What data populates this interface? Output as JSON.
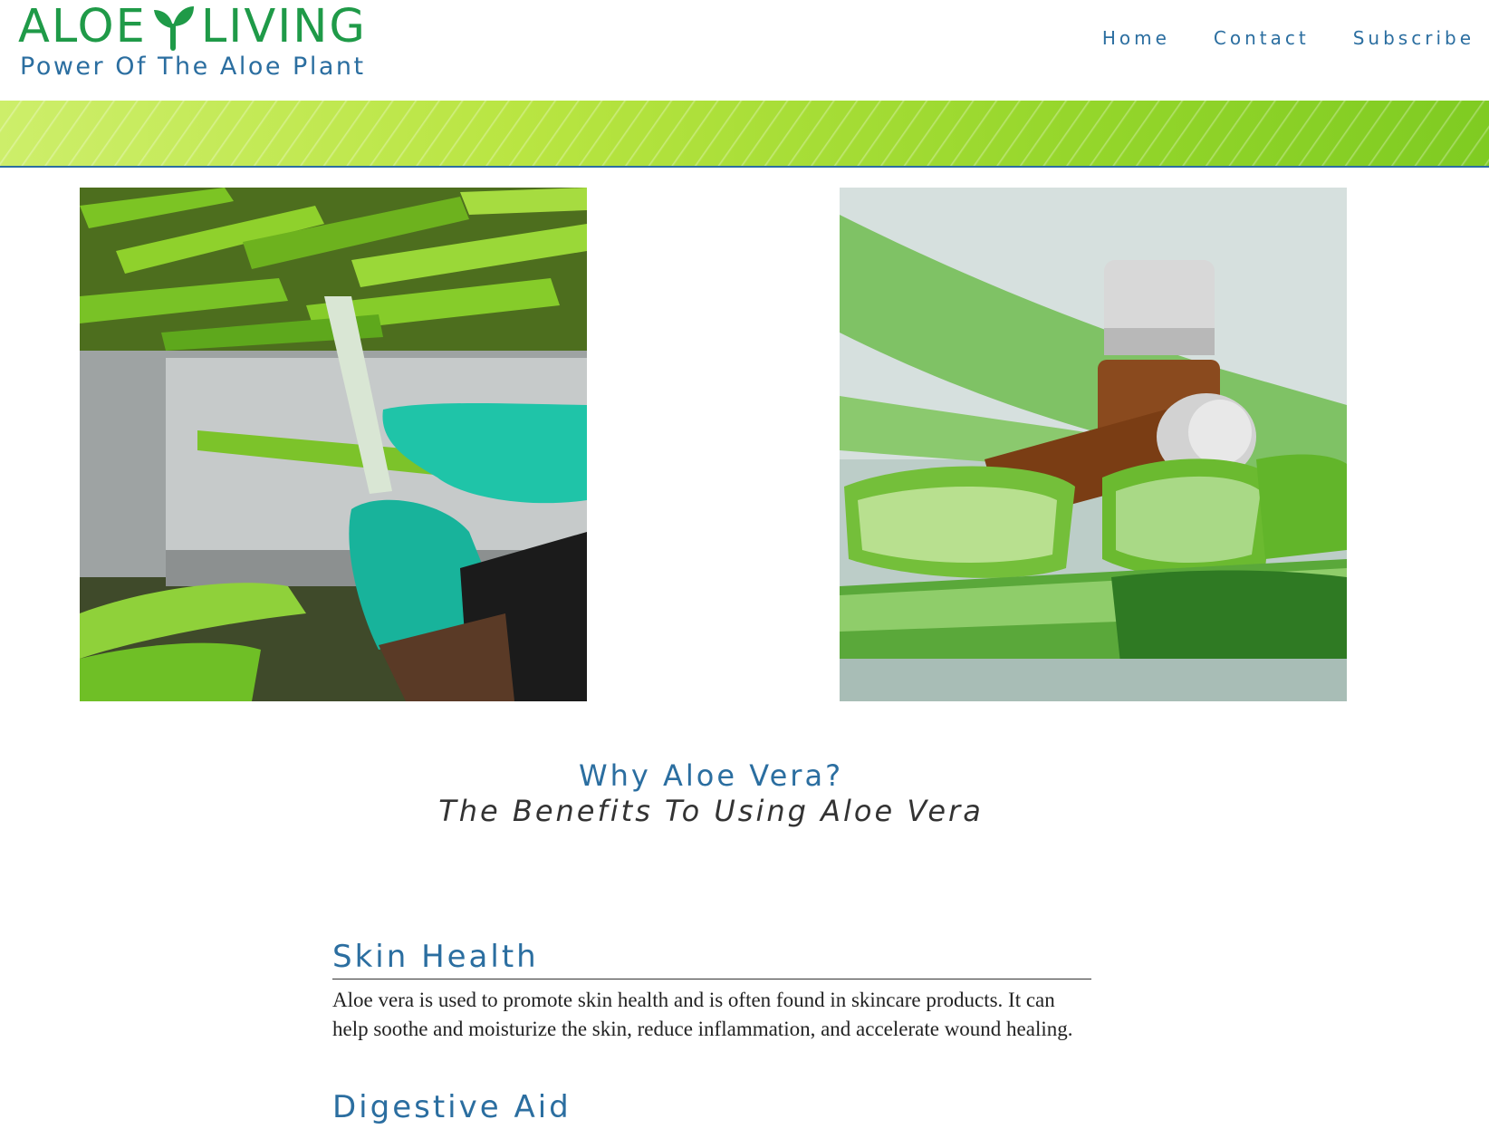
{
  "brand": {
    "name_left": "ALOE",
    "name_right": "LIVING",
    "tagline": "Power Of The Aloe Plant",
    "color": "#1f9a48"
  },
  "nav": {
    "items": [
      {
        "label": "Home"
      },
      {
        "label": "Contact"
      },
      {
        "label": "Subscribe"
      }
    ]
  },
  "intro": {
    "title": "Why Aloe Vera?",
    "subtitle": "The Benefits To Using Aloe Vera"
  },
  "sections": [
    {
      "title": "Skin Health",
      "body": "Aloe vera is used to promote skin health and is often found in skincare products. It can help soothe and moisturize the skin, reduce inflammation, and accelerate wound healing."
    },
    {
      "title": "Digestive Aid",
      "body": ""
    }
  ],
  "colors": {
    "accent": "#2b6ea0",
    "brand_green": "#1f9a48",
    "banner_green": "#a6dc34"
  }
}
